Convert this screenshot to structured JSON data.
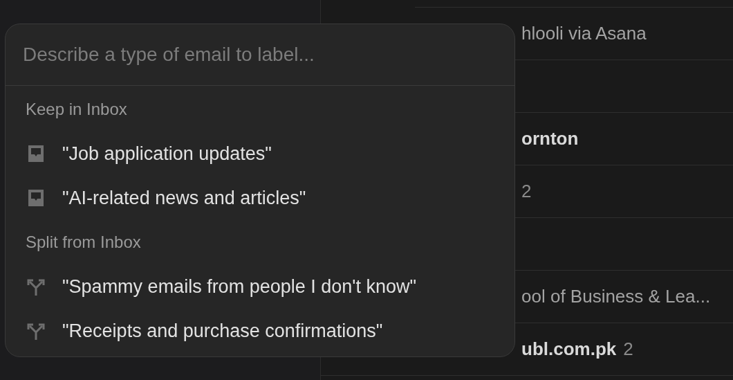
{
  "emails": [
    {
      "kind": "row",
      "sender": "hlooli via Asana",
      "unread": false
    },
    {
      "kind": "covered"
    },
    {
      "kind": "row",
      "sender": "ornton",
      "unread": true
    },
    {
      "kind": "row",
      "count": "2",
      "unread": false
    },
    {
      "kind": "covered"
    },
    {
      "kind": "row",
      "sender": "ool of Business & Lea...",
      "unread": false
    },
    {
      "kind": "row",
      "sender": "ubl.com.pk",
      "count": "2",
      "unread": true
    }
  ],
  "label_popup": {
    "search": {
      "placeholder": "Describe a type of email to label..."
    },
    "sections": [
      {
        "title": "Keep in Inbox",
        "kind": "keep",
        "items": [
          {
            "label": "\"Job application updates\""
          },
          {
            "label": "\"AI-related news and articles\""
          }
        ]
      },
      {
        "title": "Split from Inbox",
        "kind": "split",
        "items": [
          {
            "label": "\"Spammy emails from people I don't know\""
          },
          {
            "label": "\"Receipts and purchase confirmations\""
          }
        ]
      }
    ]
  }
}
